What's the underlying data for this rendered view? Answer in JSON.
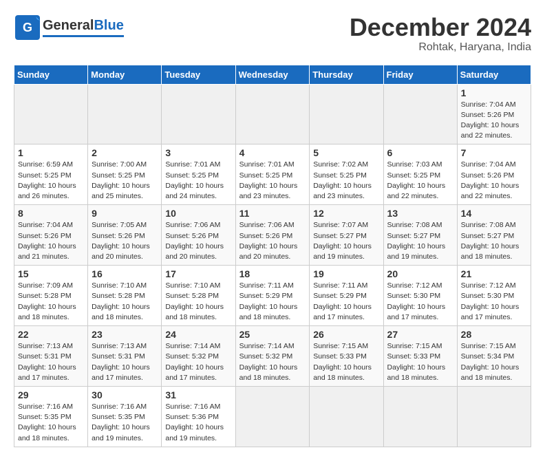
{
  "header": {
    "logo_general": "General",
    "logo_blue": "Blue",
    "title": "December 2024",
    "subtitle": "Rohtak, Haryana, India"
  },
  "calendar": {
    "days_of_week": [
      "Sunday",
      "Monday",
      "Tuesday",
      "Wednesday",
      "Thursday",
      "Friday",
      "Saturday"
    ],
    "weeks": [
      [
        null,
        null,
        null,
        null,
        null,
        null,
        {
          "day": "1",
          "sunrise": "Sunrise: 7:04 AM",
          "sunset": "Sunset: 5:26 PM",
          "daylight": "Daylight: 10 hours and 22 minutes."
        }
      ],
      [
        {
          "day": "1",
          "sunrise": "Sunrise: 6:59 AM",
          "sunset": "Sunset: 5:25 PM",
          "daylight": "Daylight: 10 hours and 26 minutes."
        },
        {
          "day": "2",
          "sunrise": "Sunrise: 7:00 AM",
          "sunset": "Sunset: 5:25 PM",
          "daylight": "Daylight: 10 hours and 25 minutes."
        },
        {
          "day": "3",
          "sunrise": "Sunrise: 7:01 AM",
          "sunset": "Sunset: 5:25 PM",
          "daylight": "Daylight: 10 hours and 24 minutes."
        },
        {
          "day": "4",
          "sunrise": "Sunrise: 7:01 AM",
          "sunset": "Sunset: 5:25 PM",
          "daylight": "Daylight: 10 hours and 23 minutes."
        },
        {
          "day": "5",
          "sunrise": "Sunrise: 7:02 AM",
          "sunset": "Sunset: 5:25 PM",
          "daylight": "Daylight: 10 hours and 23 minutes."
        },
        {
          "day": "6",
          "sunrise": "Sunrise: 7:03 AM",
          "sunset": "Sunset: 5:25 PM",
          "daylight": "Daylight: 10 hours and 22 minutes."
        },
        {
          "day": "7",
          "sunrise": "Sunrise: 7:04 AM",
          "sunset": "Sunset: 5:26 PM",
          "daylight": "Daylight: 10 hours and 22 minutes."
        }
      ],
      [
        {
          "day": "8",
          "sunrise": "Sunrise: 7:04 AM",
          "sunset": "Sunset: 5:26 PM",
          "daylight": "Daylight: 10 hours and 21 minutes."
        },
        {
          "day": "9",
          "sunrise": "Sunrise: 7:05 AM",
          "sunset": "Sunset: 5:26 PM",
          "daylight": "Daylight: 10 hours and 20 minutes."
        },
        {
          "day": "10",
          "sunrise": "Sunrise: 7:06 AM",
          "sunset": "Sunset: 5:26 PM",
          "daylight": "Daylight: 10 hours and 20 minutes."
        },
        {
          "day": "11",
          "sunrise": "Sunrise: 7:06 AM",
          "sunset": "Sunset: 5:26 PM",
          "daylight": "Daylight: 10 hours and 20 minutes."
        },
        {
          "day": "12",
          "sunrise": "Sunrise: 7:07 AM",
          "sunset": "Sunset: 5:27 PM",
          "daylight": "Daylight: 10 hours and 19 minutes."
        },
        {
          "day": "13",
          "sunrise": "Sunrise: 7:08 AM",
          "sunset": "Sunset: 5:27 PM",
          "daylight": "Daylight: 10 hours and 19 minutes."
        },
        {
          "day": "14",
          "sunrise": "Sunrise: 7:08 AM",
          "sunset": "Sunset: 5:27 PM",
          "daylight": "Daylight: 10 hours and 18 minutes."
        }
      ],
      [
        {
          "day": "15",
          "sunrise": "Sunrise: 7:09 AM",
          "sunset": "Sunset: 5:28 PM",
          "daylight": "Daylight: 10 hours and 18 minutes."
        },
        {
          "day": "16",
          "sunrise": "Sunrise: 7:10 AM",
          "sunset": "Sunset: 5:28 PM",
          "daylight": "Daylight: 10 hours and 18 minutes."
        },
        {
          "day": "17",
          "sunrise": "Sunrise: 7:10 AM",
          "sunset": "Sunset: 5:28 PM",
          "daylight": "Daylight: 10 hours and 18 minutes."
        },
        {
          "day": "18",
          "sunrise": "Sunrise: 7:11 AM",
          "sunset": "Sunset: 5:29 PM",
          "daylight": "Daylight: 10 hours and 18 minutes."
        },
        {
          "day": "19",
          "sunrise": "Sunrise: 7:11 AM",
          "sunset": "Sunset: 5:29 PM",
          "daylight": "Daylight: 10 hours and 17 minutes."
        },
        {
          "day": "20",
          "sunrise": "Sunrise: 7:12 AM",
          "sunset": "Sunset: 5:30 PM",
          "daylight": "Daylight: 10 hours and 17 minutes."
        },
        {
          "day": "21",
          "sunrise": "Sunrise: 7:12 AM",
          "sunset": "Sunset: 5:30 PM",
          "daylight": "Daylight: 10 hours and 17 minutes."
        }
      ],
      [
        {
          "day": "22",
          "sunrise": "Sunrise: 7:13 AM",
          "sunset": "Sunset: 5:31 PM",
          "daylight": "Daylight: 10 hours and 17 minutes."
        },
        {
          "day": "23",
          "sunrise": "Sunrise: 7:13 AM",
          "sunset": "Sunset: 5:31 PM",
          "daylight": "Daylight: 10 hours and 17 minutes."
        },
        {
          "day": "24",
          "sunrise": "Sunrise: 7:14 AM",
          "sunset": "Sunset: 5:32 PM",
          "daylight": "Daylight: 10 hours and 17 minutes."
        },
        {
          "day": "25",
          "sunrise": "Sunrise: 7:14 AM",
          "sunset": "Sunset: 5:32 PM",
          "daylight": "Daylight: 10 hours and 18 minutes."
        },
        {
          "day": "26",
          "sunrise": "Sunrise: 7:15 AM",
          "sunset": "Sunset: 5:33 PM",
          "daylight": "Daylight: 10 hours and 18 minutes."
        },
        {
          "day": "27",
          "sunrise": "Sunrise: 7:15 AM",
          "sunset": "Sunset: 5:33 PM",
          "daylight": "Daylight: 10 hours and 18 minutes."
        },
        {
          "day": "28",
          "sunrise": "Sunrise: 7:15 AM",
          "sunset": "Sunset: 5:34 PM",
          "daylight": "Daylight: 10 hours and 18 minutes."
        }
      ],
      [
        {
          "day": "29",
          "sunrise": "Sunrise: 7:16 AM",
          "sunset": "Sunset: 5:35 PM",
          "daylight": "Daylight: 10 hours and 18 minutes."
        },
        {
          "day": "30",
          "sunrise": "Sunrise: 7:16 AM",
          "sunset": "Sunset: 5:35 PM",
          "daylight": "Daylight: 10 hours and 19 minutes."
        },
        {
          "day": "31",
          "sunrise": "Sunrise: 7:16 AM",
          "sunset": "Sunset: 5:36 PM",
          "daylight": "Daylight: 10 hours and 19 minutes."
        },
        null,
        null,
        null,
        null
      ]
    ]
  }
}
